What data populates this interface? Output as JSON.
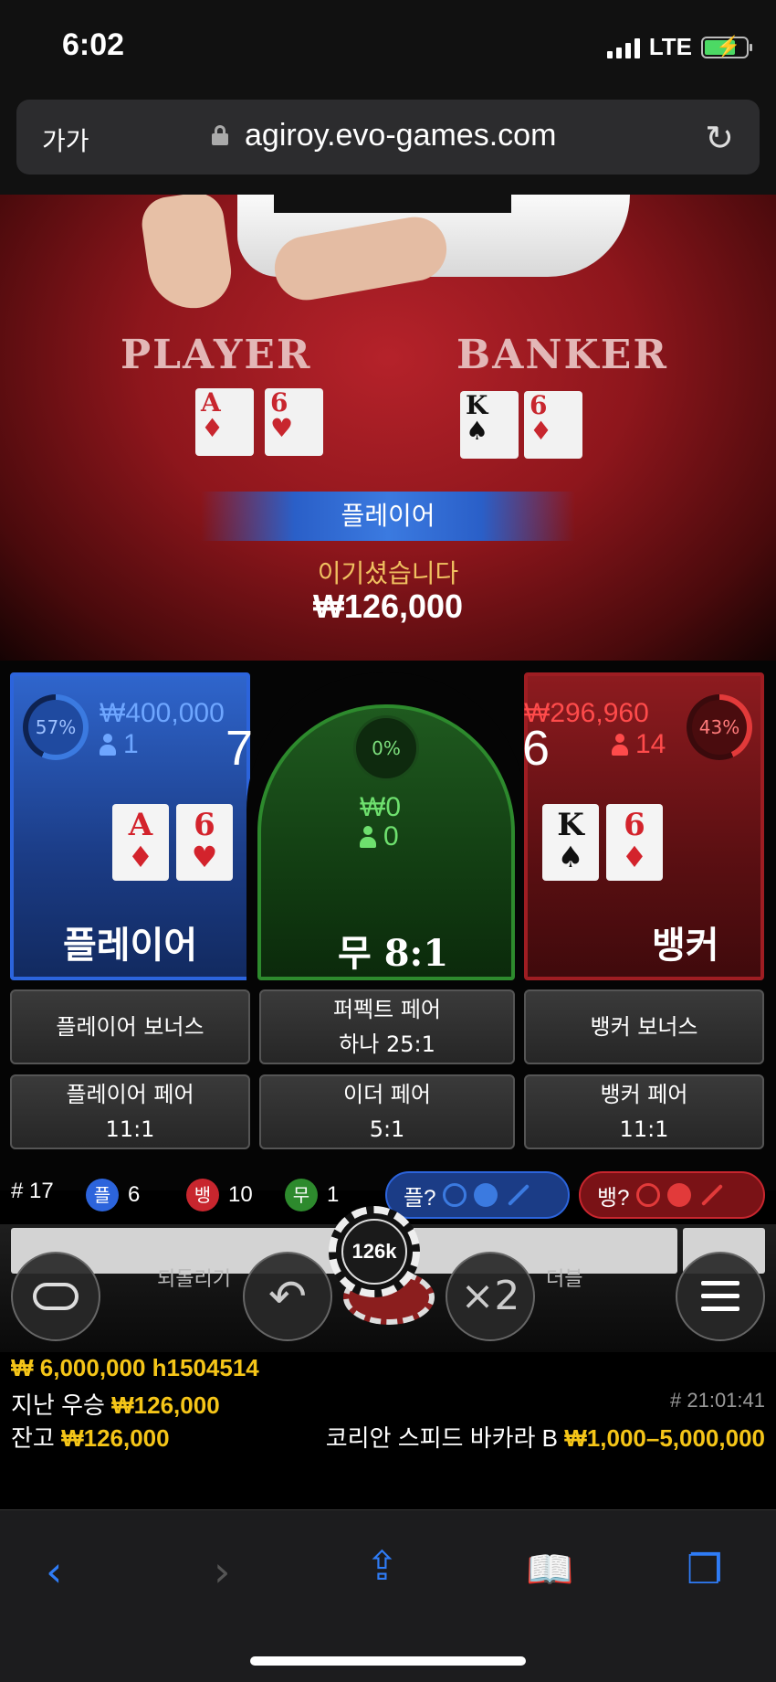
{
  "status_bar": {
    "time": "6:02",
    "network": "LTE"
  },
  "browser": {
    "text_size": "가가",
    "url": "agiroy.evo-games.com"
  },
  "table": {
    "player_label": "PLAYER",
    "banker_label": "BANKER",
    "player_cards": [
      {
        "rank": "A",
        "suit": "♦",
        "color": "#c8262e"
      },
      {
        "rank": "6",
        "suit": "♥",
        "color": "#c8262e"
      }
    ],
    "banker_cards": [
      {
        "rank": "K",
        "suit": "♠",
        "color": "#111111"
      },
      {
        "rank": "6",
        "suit": "♦",
        "color": "#c8262e"
      }
    ]
  },
  "result": {
    "winner": "플레이어",
    "message": "이기셨습니다",
    "amount": "₩126,000"
  },
  "board": {
    "player": {
      "percent": "57%",
      "amount": "₩400,000",
      "players": "1",
      "score": "7",
      "name": "플레이어"
    },
    "tie": {
      "percent": "0%",
      "amount": "₩0",
      "players": "0",
      "name": "무 8:1"
    },
    "banker": {
      "percent": "43%",
      "amount": "₩296,960",
      "players": "14",
      "score": "6",
      "name": "뱅커"
    }
  },
  "side_bets": [
    {
      "line1": "플레이어 보너스",
      "line2": ""
    },
    {
      "line1": "퍼펙트 페어",
      "line2": "하나 25:1"
    },
    {
      "line1": "뱅커 보너스",
      "line2": ""
    },
    {
      "line1": "플레이어 페어",
      "line2": "11:1"
    },
    {
      "line1": "이더 페어",
      "line2": "5:1"
    },
    {
      "line1": "뱅커 페어",
      "line2": "11:1"
    }
  ],
  "stats": {
    "round": "# 17",
    "player_label": "플",
    "player_count": "6",
    "banker_label": "뱅",
    "banker_count": "10",
    "tie_label": "무",
    "tie_count": "1",
    "player_predict": "플?",
    "banker_predict": "뱅?"
  },
  "controls": {
    "undo_label": "되돌리기",
    "chip_value": "126k",
    "double_symbol": "×2",
    "double_label": "더블"
  },
  "info": {
    "balance_line": "₩ 6,000,000 h1504514",
    "last_win_label": "지난 우승",
    "last_win_amount": "₩126,000",
    "timestamp": "# 21:01:41",
    "balance_label": "잔고",
    "balance_amount": "₩126,000",
    "table_name": "코리안 스피드 바카라 B",
    "limits": "₩1,000–5,000,000"
  },
  "colors": {
    "player_blue": "#2c64dc",
    "banker_red": "#d3232c",
    "tie_green": "#2d8a2d",
    "gold": "#f5c518",
    "ios_blue": "#2f7cf6"
  }
}
